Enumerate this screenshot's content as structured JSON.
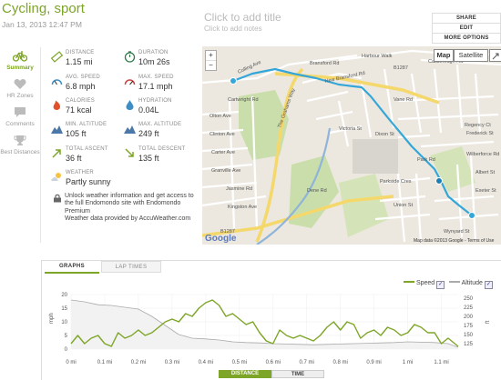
{
  "header": {
    "title": "Cycling, sport",
    "date": "Jan 13, 2013 12:47 PM",
    "add_title": "Click to add title",
    "add_notes": "Click to add notes"
  },
  "actions": {
    "share": "SHARE",
    "edit": "EDIT",
    "more": "MORE OPTIONS"
  },
  "nav": [
    {
      "label": "Summary",
      "icon": "bicycle-icon",
      "active": true
    },
    {
      "label": "HR Zones",
      "icon": "heart-icon"
    },
    {
      "label": "Comments",
      "icon": "speech-bubble-icon"
    },
    {
      "label": "Best Distances",
      "icon": "trophy-icon"
    }
  ],
  "stats": {
    "distance": {
      "label": "DISTANCE",
      "value": "1.15 mi"
    },
    "duration": {
      "label": "DURATION",
      "value": "10m 26s"
    },
    "avg_speed": {
      "label": "AVG. SPEED",
      "value": "6.8 mph"
    },
    "max_speed": {
      "label": "MAX. SPEED",
      "value": "17.1 mph"
    },
    "calories": {
      "label": "CALORIES",
      "value": "71 kcal"
    },
    "hydration": {
      "label": "HYDRATION",
      "value": "0.04L"
    },
    "min_altitude": {
      "label": "MIN. ALTITUDE",
      "value": "105 ft"
    },
    "max_altitude": {
      "label": "MAX. ALTITUDE",
      "value": "249 ft"
    },
    "total_ascent": {
      "label": "TOTAL ASCENT",
      "value": "36 ft"
    },
    "total_descent": {
      "label": "TOTAL DESCENT",
      "value": "135 ft"
    },
    "weather": {
      "label": "WEATHER",
      "value": "Partly sunny"
    }
  },
  "unlock_text": "Unlock weather information and get access to the full Endomondo site with Endomondo Premium",
  "weather_credit": "Weather data provided by AccuWeather.com",
  "map": {
    "type_map": "Map",
    "type_satellite": "Satellite",
    "attribution": "Map data ©2013 Google - Terms of Use",
    "logo": "Google",
    "zoom_in": "+",
    "zoom_out": "−",
    "labels": {
      "l1": "Harbour Walk",
      "l2": "Castlereagh Rd",
      "l3": "B1287",
      "l4": "New Bransford Rd",
      "l5": "Bransford Rd",
      "l6": "Colling Ave",
      "l7": "Cartwright Rd",
      "l8": "The Grahams Way",
      "l9": "Olton Ave",
      "l10": "Clinton Ave",
      "l11": "Carter Ave",
      "l12": "Granville Ave",
      "l13": "Jasmine Rd",
      "l14": "Kingston Ave",
      "l15": "Victoria St",
      "l16": "Vane Rd",
      "l17": "Regency Ct",
      "l18": "Frederick St",
      "l19": "Dene Rd",
      "l20": "Parkside Cres",
      "l21": "Dixon St",
      "l22": "Union St",
      "l23": "Wilberforce Rd",
      "l24": "Albert St",
      "l25": "Exeter St",
      "l26": "Wynyard St",
      "l27": "Park Rd",
      "l28": "B1287"
    }
  },
  "graph": {
    "tabs": [
      "GRAPHS",
      "LAP TIMES"
    ],
    "legend": {
      "speed": "Speed",
      "altitude": "Altitude"
    },
    "checked": "✓",
    "left_axis_label": "mph",
    "right_axis_label": "ft",
    "toggle_distance": "DISTANCE",
    "toggle_time": "TIME"
  },
  "chart_data": {
    "type": "line",
    "xlabel": "",
    "x_ticks": [
      "0 mi",
      "0.1 mi",
      "0.2 mi",
      "0.3 mi",
      "0.4 mi",
      "0.5 mi",
      "0.6 mi",
      "0.7 mi",
      "0.8 mi",
      "0.9 mi",
      "1 mi",
      "1.1 mi"
    ],
    "y_left": {
      "label": "mph",
      "ticks": [
        0,
        5,
        10,
        15,
        20
      ],
      "lim": [
        0,
        20
      ]
    },
    "y_right": {
      "label": "ft",
      "ticks": [
        125,
        150,
        175,
        200,
        225,
        250
      ],
      "lim": [
        110,
        260
      ]
    },
    "colors": {
      "speed": "#7da527",
      "altitude": "#aaaaaa",
      "altitude_fill": "#f2f2f2"
    },
    "series": [
      {
        "name": "Speed",
        "axis": "left",
        "x": [
          0,
          0.02,
          0.04,
          0.06,
          0.08,
          0.1,
          0.12,
          0.14,
          0.16,
          0.18,
          0.2,
          0.22,
          0.24,
          0.26,
          0.28,
          0.3,
          0.32,
          0.34,
          0.36,
          0.38,
          0.4,
          0.42,
          0.44,
          0.46,
          0.48,
          0.5,
          0.52,
          0.54,
          0.56,
          0.58,
          0.6,
          0.62,
          0.64,
          0.66,
          0.68,
          0.7,
          0.72,
          0.74,
          0.76,
          0.78,
          0.8,
          0.82,
          0.84,
          0.86,
          0.88,
          0.9,
          0.92,
          0.94,
          0.96,
          0.98,
          1.0,
          1.02,
          1.04,
          1.06,
          1.08,
          1.1,
          1.12,
          1.14,
          1.15
        ],
        "values": [
          2,
          5,
          2,
          4,
          5,
          2,
          1,
          6,
          4,
          5,
          7,
          5,
          6,
          8,
          10,
          11,
          10,
          13,
          12,
          15,
          17,
          18,
          16,
          12,
          13,
          11,
          9,
          10,
          6,
          3,
          2,
          7,
          5,
          4,
          5,
          4,
          3,
          5,
          8,
          10,
          7,
          10,
          9,
          4,
          6,
          7,
          5,
          8,
          7,
          5,
          6,
          9,
          8,
          6,
          6,
          2,
          4,
          2,
          1
        ]
      },
      {
        "name": "Altitude",
        "axis": "right",
        "x": [
          0,
          0.04,
          0.08,
          0.12,
          0.16,
          0.2,
          0.24,
          0.28,
          0.32,
          0.36,
          0.4,
          0.44,
          0.48,
          0.52,
          0.56,
          0.6,
          0.64,
          0.68,
          0.72,
          0.76,
          0.8,
          0.84,
          0.88,
          0.92,
          0.96,
          1.0,
          1.04,
          1.08,
          1.12,
          1.15
        ],
        "values": [
          245,
          240,
          232,
          230,
          225,
          220,
          200,
          175,
          150,
          140,
          138,
          135,
          130,
          128,
          127,
          125,
          124,
          123,
          122,
          123,
          124,
          125,
          126,
          127,
          128,
          130,
          129,
          128,
          125,
          115
        ]
      }
    ]
  }
}
